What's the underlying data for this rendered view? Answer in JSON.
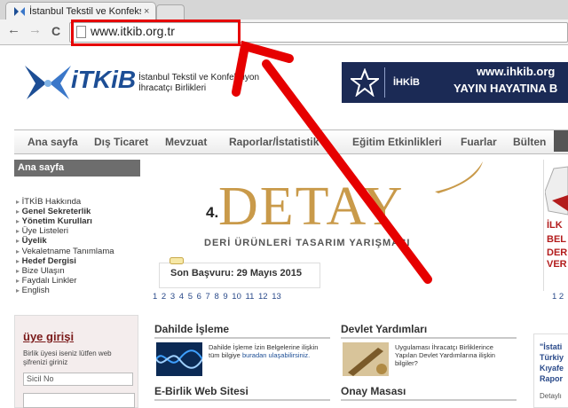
{
  "browser": {
    "tab_title": "İstanbul Tekstil ve Konfeksiyon",
    "tab_close": "×",
    "back": "←",
    "forward": "→",
    "reload": "C",
    "url": "www.itkib.org.tr"
  },
  "header": {
    "logo_text": "iTKiB",
    "org_line1": "İstanbul Tekstil ve Konfeksiyon",
    "org_line2": "İhracatçı Birlikleri",
    "banner": {
      "brand": "İHKİB",
      "url": "www.ihkib.org",
      "tagline": "YAYIN HAYATINA B"
    }
  },
  "nav": {
    "items": [
      "Ana sayfa",
      "Dış Ticaret",
      "Mevzuat",
      "Raporlar/İstatistik",
      "Eğitim Etkinlikleri",
      "Fuarlar",
      "Bülten"
    ]
  },
  "sidebar": {
    "title": "Ana sayfa",
    "items": [
      {
        "label": "İTKİB Hakkında",
        "bold": false
      },
      {
        "label": "Genel Sekreterlik",
        "bold": true
      },
      {
        "label": "Yönetim Kurulları",
        "bold": true
      },
      {
        "label": "Üye Listeleri",
        "bold": false
      },
      {
        "label": "Üyelik",
        "bold": true
      },
      {
        "label": "Vekaletname Tanımlama",
        "bold": false
      },
      {
        "label": "Hedef Dergisi",
        "bold": true
      },
      {
        "label": "Bize Ulaşın",
        "bold": false
      },
      {
        "label": "Faydalı Linkler",
        "bold": false
      },
      {
        "label": "English",
        "bold": false
      }
    ]
  },
  "login": {
    "title": "üye girişi",
    "info_line1": "Birlik üyesi iseniz lütfen web",
    "info_line2": "şifrenizi giriniz",
    "placeholder": "Sicil No"
  },
  "slider": {
    "number": "4.",
    "word": "DETAY",
    "subtitle": "DERİ ÜRÜNLERİ TASARIM YARIŞMASI",
    "deadline": "Son Başvuru: 29 Mayıs 2015",
    "pages": "1 2 3 4 5 6 7 8 9 10 11 12 13"
  },
  "right_promo": {
    "lines": [
      "İLK",
      "BEL",
      "DER",
      "VER"
    ],
    "pages": "1 2"
  },
  "boxes": {
    "dahilde": {
      "title": "Dahilde İşleme",
      "text1": "Dahilde İşleme İzin Belgelerine ilişkin",
      "text2": "tüm bilgiye ",
      "link": "buradan ulaşabilirsiniz."
    },
    "devlet": {
      "title": "Devlet Yardımları",
      "text1": "Uygulaması İhracatçı Birliklerince",
      "text2": "Yapılan Devlet Yardımlarına ilişkin",
      "text3": "bilgiler?"
    },
    "ebirlik": {
      "title": "E-Birlik Web Sitesi"
    },
    "onay": {
      "title": "Onay Masası"
    }
  },
  "right_column": {
    "lines": [
      "\"İstati",
      "Türkiy",
      "Kıyafe",
      "Rapor"
    ],
    "detail": "Detaylı"
  },
  "colors": {
    "annotation_red": "#e60000",
    "brand_blue": "#1d4e95",
    "gold": "#c99a4a"
  }
}
